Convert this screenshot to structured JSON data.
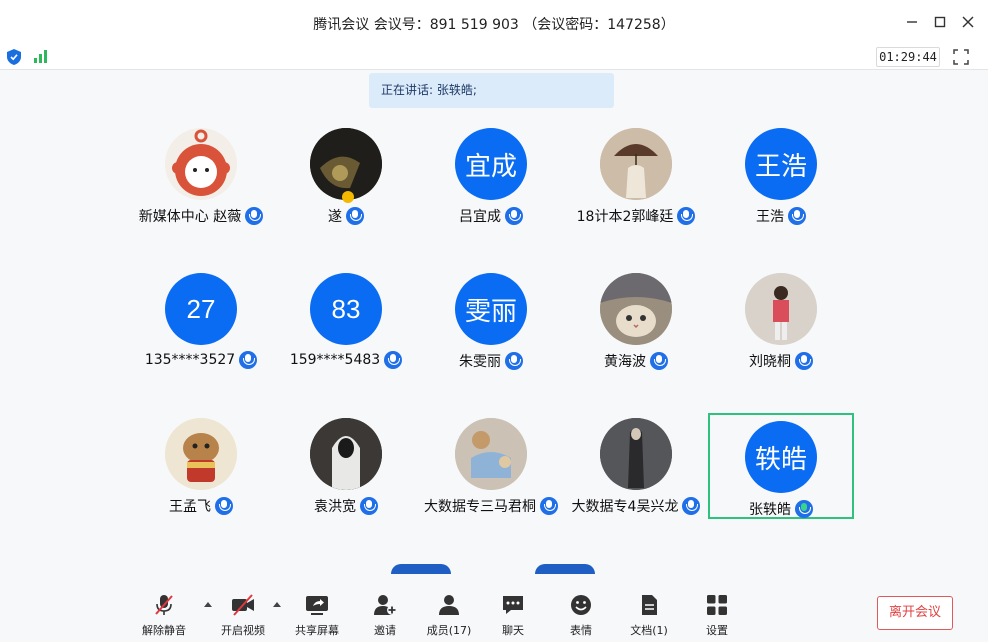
{
  "window": {
    "title": "腾讯会议  会议号：891 519 903  （会议密码：147258）",
    "timer": "01:29:44"
  },
  "speaking_banner": "正在讲话: 张轶皓;",
  "participants": [
    {
      "name": "新媒体中心 赵薇",
      "avatar": "photo-mascot",
      "initials": ""
    },
    {
      "name": "遂",
      "avatar": "photo-dark",
      "initials": ""
    },
    {
      "name": "吕宜成",
      "avatar": "initials",
      "initials": "宜成"
    },
    {
      "name": "18计本2郭峰廷",
      "avatar": "photo-umbrella",
      "initials": ""
    },
    {
      "name": "王浩",
      "avatar": "initials",
      "initials": "王浩"
    },
    {
      "name": "135****3527",
      "avatar": "initials",
      "initials": "27"
    },
    {
      "name": "159****5483",
      "avatar": "initials",
      "initials": "83"
    },
    {
      "name": "朱雯丽",
      "avatar": "initials",
      "initials": "雯丽"
    },
    {
      "name": "黄海波",
      "avatar": "photo-cat",
      "initials": ""
    },
    {
      "name": "刘晓桐",
      "avatar": "photo-person",
      "initials": ""
    },
    {
      "name": "王孟飞",
      "avatar": "photo-cartoon",
      "initials": ""
    },
    {
      "name": "袁洪宽",
      "avatar": "photo-hoodie",
      "initials": ""
    },
    {
      "name": "大数据专三马君桐",
      "avatar": "photo-dog",
      "initials": ""
    },
    {
      "name": "大数据专4吴兴龙",
      "avatar": "photo-figure",
      "initials": ""
    },
    {
      "name": "张轶皓",
      "avatar": "initials",
      "initials": "轶皓",
      "speaking": true
    }
  ],
  "toolbar": {
    "unmute": "解除静音",
    "video": "开启视频",
    "share": "共享屏幕",
    "invite": "邀请",
    "members": "成员(17)",
    "chat": "聊天",
    "reactions": "表情",
    "docs": "文档(1)",
    "settings": "设置",
    "leave": "离开会议"
  },
  "colors": {
    "accent": "#0a6cf2",
    "speaking_border": "#2ec27e",
    "leave": "#e04242"
  }
}
